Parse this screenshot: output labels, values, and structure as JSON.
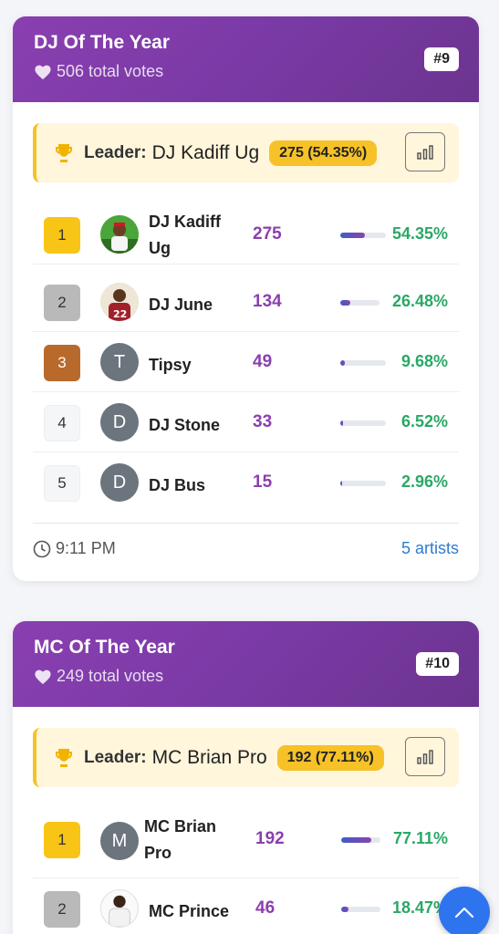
{
  "categories": [
    {
      "title": "DJ Of The Year",
      "total_votes": "506 total votes",
      "rank": "#9",
      "leader": {
        "label": "Leader:",
        "name": "DJ Kadiff Ug",
        "stat": "275 (54.35%)"
      },
      "rows": [
        {
          "rank": "1",
          "avatar": "photo",
          "name": "DJ Kadiff Ug",
          "votes": "275",
          "pct": "54.35%",
          "fill": 0.5435
        },
        {
          "rank": "2",
          "avatar": "photo",
          "name": "DJ June",
          "votes": "134",
          "pct": "26.48%",
          "fill": 0.2648
        },
        {
          "rank": "3",
          "avatar": "T",
          "name": "Tipsy",
          "votes": "49",
          "pct": "9.68%",
          "fill": 0.0968
        },
        {
          "rank": "4",
          "avatar": "D",
          "name": "DJ Stone",
          "votes": "33",
          "pct": "6.52%",
          "fill": 0.0652
        },
        {
          "rank": "5",
          "avatar": "D",
          "name": "DJ Bus",
          "votes": "15",
          "pct": "2.96%",
          "fill": 0.0296
        }
      ],
      "footer": {
        "time": "9:11 PM",
        "artists": "5 artists"
      }
    },
    {
      "title": "MC Of The Year",
      "total_votes": "249 total votes",
      "rank": "#10",
      "leader": {
        "label": "Leader:",
        "name": "MC Brian Pro",
        "stat": "192 (77.11%)"
      },
      "rows": [
        {
          "rank": "1",
          "avatar": "M",
          "name": "MC Brian Pro",
          "votes": "192",
          "pct": "77.11%",
          "fill": 0.7711
        },
        {
          "rank": "2",
          "avatar": "photo",
          "name": "MC Prince",
          "votes": "46",
          "pct": "18.47%",
          "fill": 0.1847
        }
      ]
    }
  ],
  "icons": {
    "heart": "heart-icon",
    "trophy": "trophy-icon",
    "chart": "bar-chart-icon",
    "clock": "clock-icon",
    "scroll_top": "chevron-up-icon"
  },
  "colors": {
    "header_purple": "#8a3fb0",
    "votes_purple": "#8b3fae",
    "percent_green": "#2aa866",
    "leader_gold": "#f6c227",
    "link_blue": "#2f7bd1",
    "fab_blue": "#2e74ee"
  }
}
